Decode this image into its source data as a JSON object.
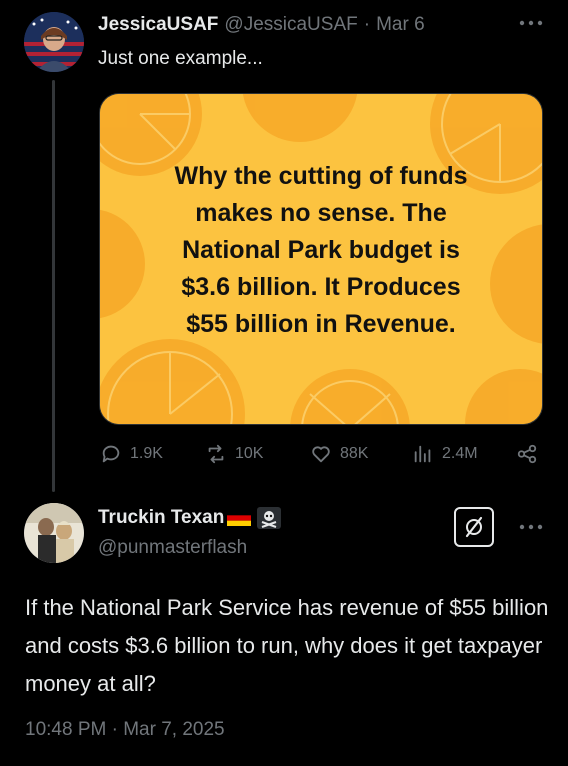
{
  "tweet": {
    "display_name": "JessicaUSAF",
    "handle": "@JessicaUSAF",
    "separator": "·",
    "date": "Mar 6",
    "text": "Just one example...",
    "more_icon": "ellipsis-icon",
    "media": {
      "lines": [
        "Why the cutting of funds",
        "makes no sense. The",
        "National Park budget is",
        "$3.6 billion. It Produces",
        "$55 billion in Revenue."
      ],
      "background_color": "#fcc340",
      "accent_color": "#f5a623"
    },
    "actions": {
      "replies": "1.9K",
      "reposts": "10K",
      "likes": "88K",
      "views": "2.4M"
    }
  },
  "reply": {
    "display_name": "Truckin Texan",
    "flag_emoji": "🇩🇪",
    "skull_emoji": "☠️",
    "handle": "@punmasterflash",
    "text": "If the National Park Service has revenue of $55 billion and costs $3.6 billion to run, why does it get taxpayer money at all?",
    "timestamp": "10:48 PM · Mar 7, 2025"
  },
  "colors": {
    "background": "#000000",
    "text": "#e7e9ea",
    "muted": "#71767b"
  }
}
